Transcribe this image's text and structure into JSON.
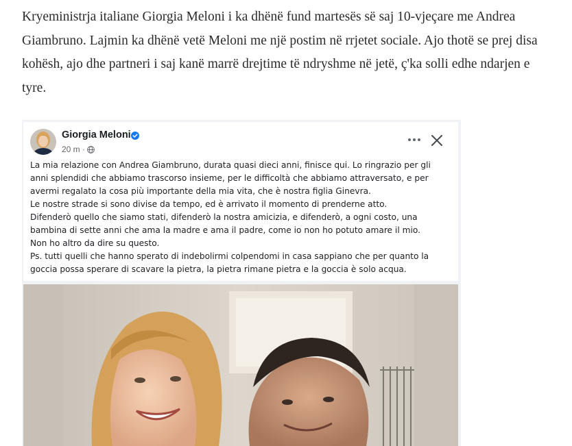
{
  "article": {
    "lines": [
      "Kryeministrja italiane Giorgia Meloni i ka dhënë fund martesës së saj 10-vjeçare me Andrea",
      "Giambruno. Lajmin ka dhënë vetë Meloni me një postim në rrjetet sociale. Ajo thotë se prej disa",
      "kohësh, ajo dhe partneri i saj kanë marrë drejtime të ndryshme në jetë, ç'ka solli edhe ndarjen e",
      "tyre."
    ]
  },
  "post": {
    "author": "Giorgia Meloni",
    "time": "20 m ·",
    "icons": {
      "verified": "verified-badge-icon",
      "privacy": "globe-icon",
      "more": "more-options-icon",
      "close": "close-icon"
    },
    "body_lines": [
      "La mia relazione con Andrea Giambruno, durata quasi dieci anni, finisce qui. Lo ringrazio per gli",
      "anni splendidi che abbiamo trascorso insieme, per le difficoltà che abbiamo attraversato, e per",
      "avermi regalato la cosa più importante della mia vita, che è nostra figlia Ginevra.",
      "Le nostre strade si sono divise da tempo, ed è arrivato il momento di prenderne atto.",
      "Difenderò quello che siamo stati, difenderò la nostra amicizia, e difenderò, a ogni costo, una",
      "bambina di sette anni che ama la madre e ama il padre, come io non ho potuto amare il mio.",
      "Non ho altro da dire su questo.",
      "Ps. tutti quelli che hanno sperato di indebolirmi colpendomi in casa sappiano che per quanto la",
      "goccia possa sperare di scavare la pietra, la pietra rimane pietra e la goccia è solo acqua."
    ]
  },
  "colors": {
    "facebook_blue": "#1877f2",
    "page_bg": "#f0f2f5",
    "text_primary": "#1c1e21",
    "text_secondary": "#65676b"
  }
}
